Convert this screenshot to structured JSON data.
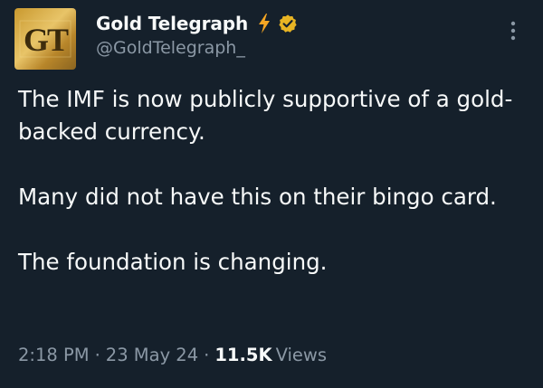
{
  "author": {
    "display_name": "Gold Telegraph",
    "handle": "@GoldTelegraph_",
    "avatar_text": "GT",
    "verified_badge_color": "#e8b423",
    "bolt_color": "#f5a623"
  },
  "tweet": {
    "paragraphs": [
      "The IMF is now publicly supportive of a gold-backed currency.",
      "Many did not have this on their bingo card.",
      "The foundation is changing."
    ]
  },
  "meta": {
    "time": "2:18 PM",
    "separator": "·",
    "date": "23 May 24",
    "views_count": "11.5K",
    "views_label": "Views"
  },
  "icons": {
    "more": "more-vertical-icon",
    "bolt": "lightning-bolt-icon",
    "verified": "verified-badge-icon"
  },
  "colors": {
    "background": "#15202b",
    "text_primary": "#f7f9f9",
    "text_secondary": "#8b98a5"
  }
}
